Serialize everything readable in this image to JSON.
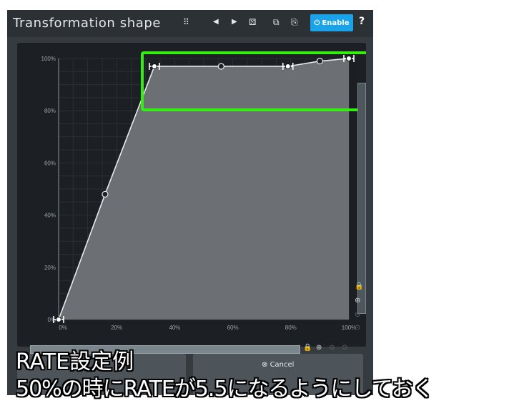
{
  "window": {
    "title": "Transformation shape"
  },
  "toolbar": {
    "grid_icon": "⠿",
    "prev_icon": "◀",
    "next_icon": "▶",
    "random_icon": "⚄",
    "copy_icon": "⧉",
    "paste_icon": "⎘",
    "enable_label": "Enable",
    "help_label": "?"
  },
  "graph": {
    "y_ticks": [
      "100%",
      "80%",
      "60%",
      "40%",
      "20%",
      "0%"
    ],
    "x_ticks": [
      "0%",
      "20%",
      "40%",
      "60%",
      "80%",
      "100%"
    ],
    "points": [
      [
        0,
        0
      ],
      [
        16,
        48
      ],
      [
        33,
        97
      ],
      [
        56,
        97
      ],
      [
        79,
        97
      ],
      [
        90,
        99
      ],
      [
        100,
        100
      ]
    ],
    "highlight_color": "#33ee11"
  },
  "buttons": {
    "cancel_label": "Cancel"
  },
  "caption": {
    "line1": "RATE設定例",
    "line2": "50%の時にRATEが5.5になるようにしておく"
  },
  "colors": {
    "accent": "#1aa3e8",
    "highlight": "#33ee11"
  }
}
